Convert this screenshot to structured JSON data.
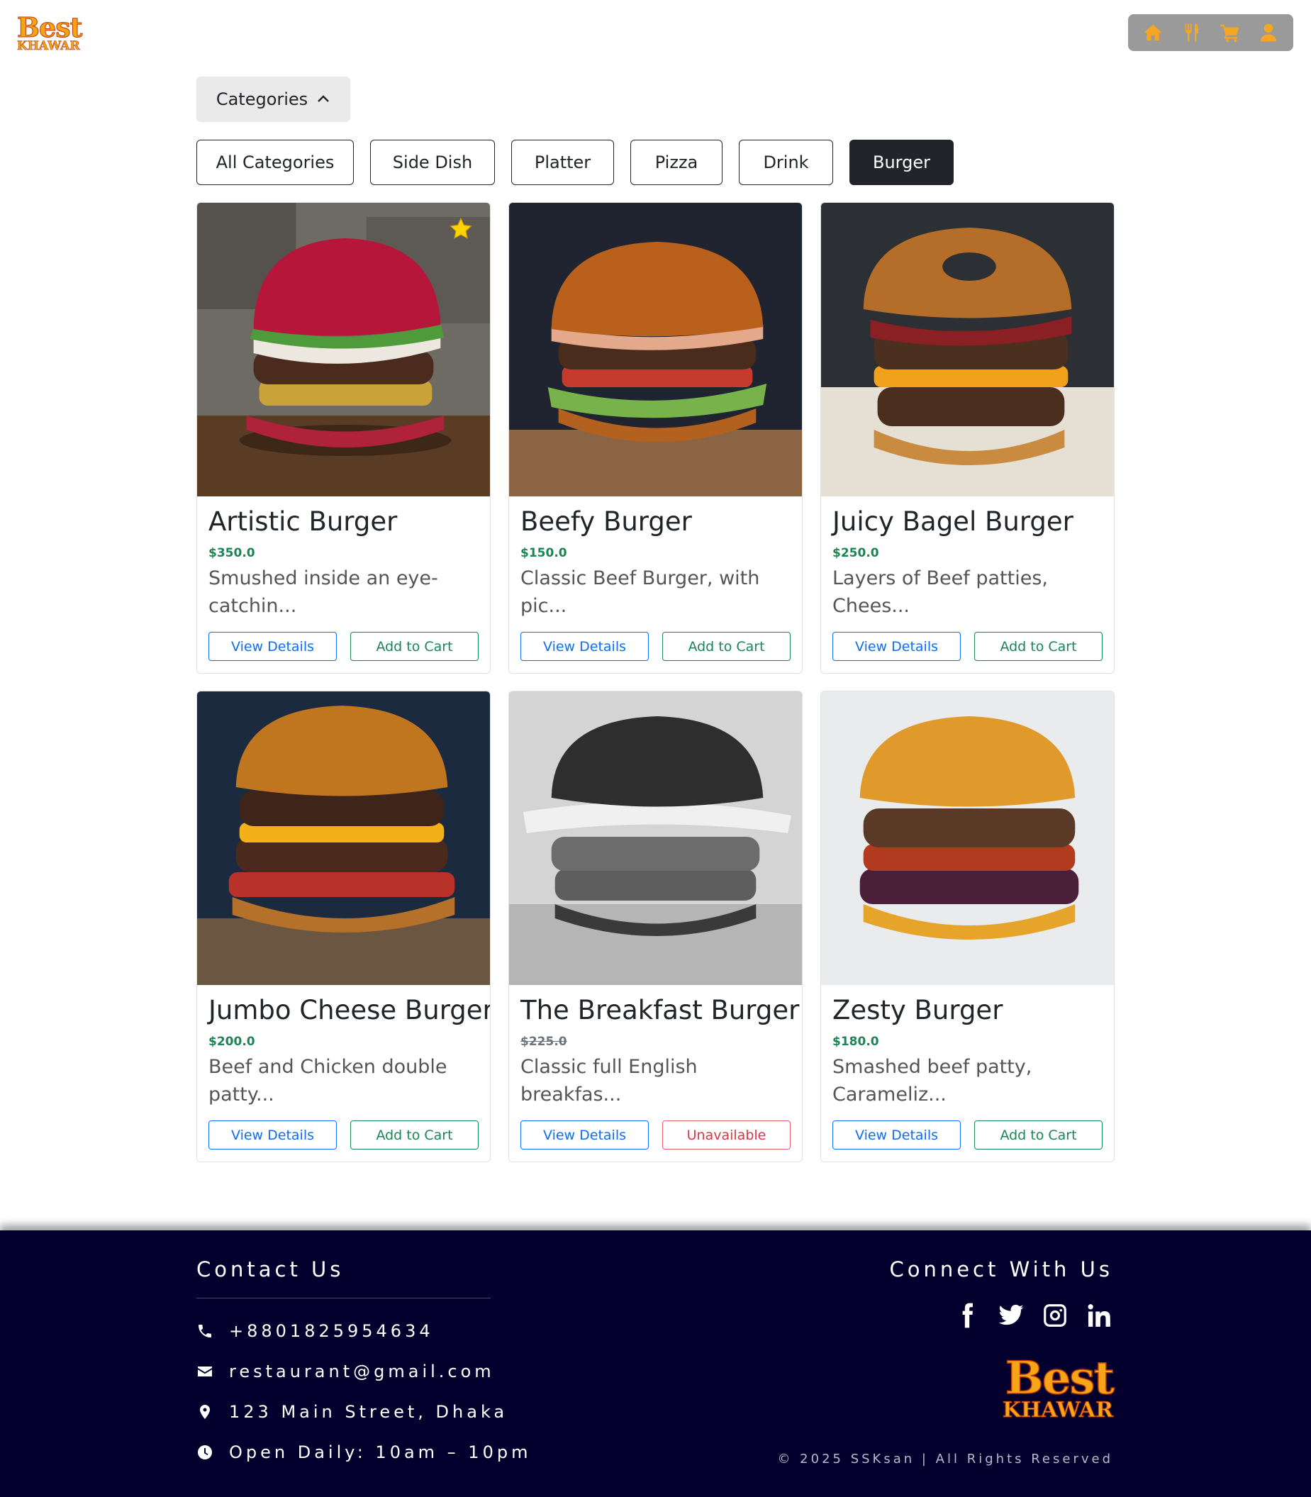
{
  "brand": {
    "logo_line1": "Best",
    "logo_line2": "KHAWAR"
  },
  "topnav": {
    "icons": [
      "home-icon",
      "utensils-icon",
      "cart-icon",
      "user-icon"
    ],
    "color": "#f5a623"
  },
  "categories_toggle": {
    "label": "Categories"
  },
  "filters": [
    {
      "label": "All Categories",
      "active": false
    },
    {
      "label": "Side Dish",
      "active": false
    },
    {
      "label": "Platter",
      "active": false
    },
    {
      "label": "Pizza",
      "active": false
    },
    {
      "label": "Drink",
      "active": false
    },
    {
      "label": "Burger",
      "active": true
    }
  ],
  "products": [
    {
      "name": "Artistic Burger",
      "price": "$350.0",
      "description": "Smushed inside an eye-catchin...",
      "available": true,
      "featured": true,
      "view_label": "View Details",
      "action_label": "Add to Cart"
    },
    {
      "name": "Beefy Burger",
      "price": "$150.0",
      "description": "Classic Beef Burger, with pic...",
      "available": true,
      "featured": false,
      "view_label": "View Details",
      "action_label": "Add to Cart"
    },
    {
      "name": "Juicy Bagel Burger",
      "price": "$250.0",
      "description": "Layers of Beef patties, Chees...",
      "available": true,
      "featured": false,
      "view_label": "View Details",
      "action_label": "Add to Cart"
    },
    {
      "name": "Jumbo Cheese Burger",
      "price": "$200.0",
      "description": "Beef and Chicken double patty...",
      "available": true,
      "featured": false,
      "view_label": "View Details",
      "action_label": "Add to Cart"
    },
    {
      "name": "The Breakfast Burger",
      "price": "$225.0",
      "description": "Classic full English breakfas...",
      "available": false,
      "featured": false,
      "view_label": "View Details",
      "action_label": "Unavailable"
    },
    {
      "name": "Zesty Burger",
      "price": "$180.0",
      "description": "Smashed beef patty, Carameliz...",
      "available": true,
      "featured": false,
      "view_label": "View Details",
      "action_label": "Add to Cart"
    }
  ],
  "footer": {
    "contact_heading": "Contact Us",
    "phone": "+8801825954634",
    "email": "restaurant@gmail.com",
    "address": "123 Main Street, Dhaka",
    "hours": "Open Daily: 10am – 10pm",
    "connect_heading": "Connect With Us",
    "social": [
      "facebook-icon",
      "twitter-icon",
      "instagram-icon",
      "linkedin-icon"
    ],
    "logo_line1": "Best",
    "logo_line2": "KHAWAR",
    "copyright": "© 2025 SSKsan | All Rights Reserved",
    "background": "#04002e"
  },
  "colors": {
    "view": "#0d6efd",
    "cart": "#198754",
    "unavailable": "#dc3545",
    "price": "#198754"
  }
}
